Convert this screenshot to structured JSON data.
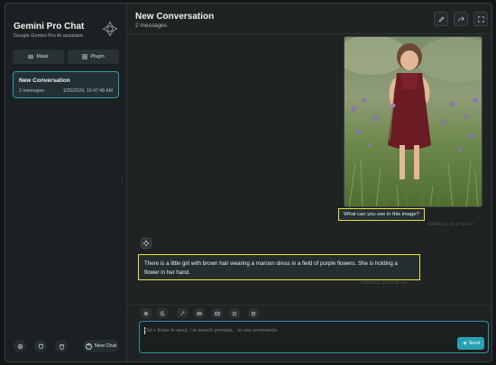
{
  "sidebar": {
    "title": "Gemini Pro Chat",
    "subtitle": "Google Gemini Pro AI assistant.",
    "mask_label": "Mask",
    "plugin_label": "Plugin",
    "conversation": {
      "title": "New Conversation",
      "count": "2 messages",
      "date": "1/25/2024, 10:47:48 AM"
    },
    "new_chat_label": "New Chat",
    "icons": [
      "gear-icon",
      "github-icon",
      "trash-icon",
      "gemini-logo-icon"
    ]
  },
  "header": {
    "title": "New Conversation",
    "subtitle": "2 messages",
    "buttons": [
      "edit-icon",
      "share-icon",
      "fullscreen-icon"
    ]
  },
  "messages": {
    "user_text": "What can you see in this image?",
    "user_time": "1/25/2024, 10:47:42 AM",
    "bot_text": "There is a little girl with brown hair wearing a maroon dress in a field of purple flowers. She is holding a flower in her hand.",
    "bot_time": "1/25/2024, 10:47:48 AM"
  },
  "input": {
    "placeholder": "Ctrl + Enter to send, / to search prompts, : to use commands",
    "value": "",
    "send_label": "Send"
  },
  "toolbar": {
    "icons": [
      "settings-icon",
      "theme-icon",
      "prompt-icon",
      "mask-icon",
      "image-upload-icon",
      "robot-icon",
      "clear-icon"
    ]
  },
  "colors": {
    "accent": "#2a9fb4",
    "highlight": "#f0e23c",
    "background": "#1f2324"
  }
}
